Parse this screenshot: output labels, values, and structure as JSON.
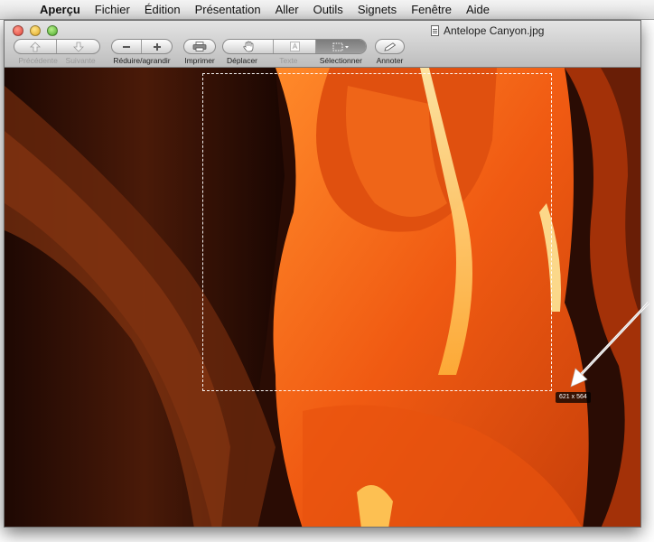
{
  "menubar": {
    "apple": "",
    "items": [
      "Aperçu",
      "Fichier",
      "Édition",
      "Présentation",
      "Aller",
      "Outils",
      "Signets",
      "Fenêtre",
      "Aide"
    ]
  },
  "window": {
    "title": "Antelope Canyon.jpg"
  },
  "toolbar": {
    "previous_label": "Précédente",
    "next_label": "Suivante",
    "zoom_label": "Réduire/agrandir",
    "print_label": "Imprimer",
    "move_label": "Déplacer",
    "text_label": "Texte",
    "select_label": "Sélectionner",
    "annotate_label": "Annoter"
  },
  "selection": {
    "size_label": "621 x 564"
  },
  "colors": {
    "close": "#e0443a",
    "minimize": "#e0a820",
    "zoom": "#4aa82a"
  }
}
